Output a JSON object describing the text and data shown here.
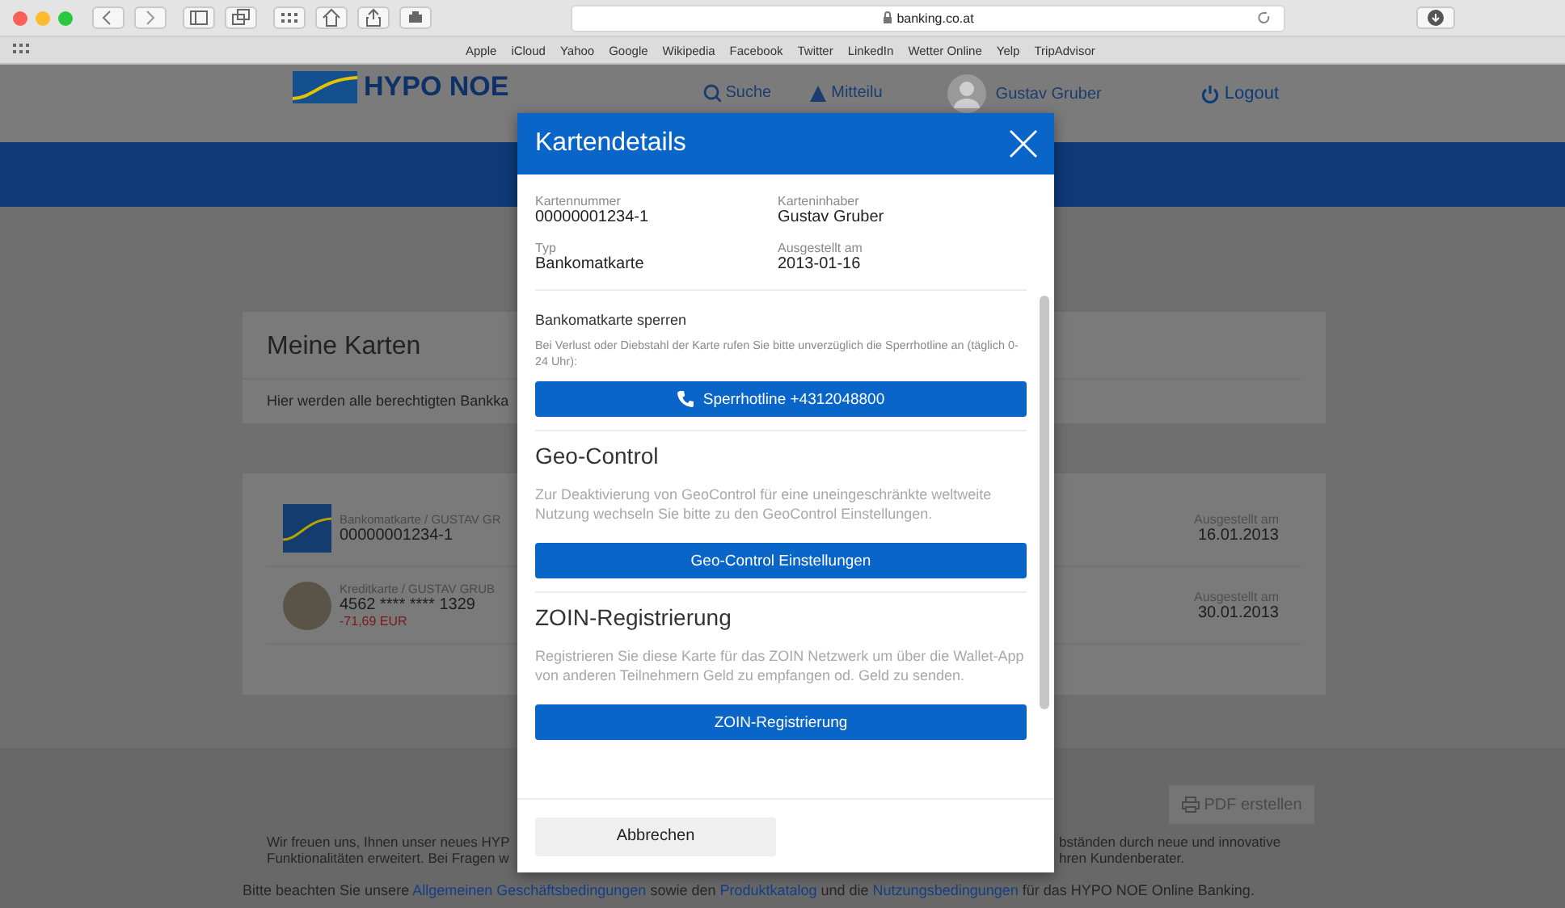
{
  "browser": {
    "url": "banking.co.at",
    "bookmarks": [
      "Apple",
      "iCloud",
      "Yahoo",
      "Google",
      "Wikipedia",
      "Facebook",
      "Twitter",
      "LinkedIn",
      "Wetter Online",
      "Yelp",
      "TripAdvisor"
    ]
  },
  "header": {
    "logo": "HYPO NOE",
    "search": "Suche",
    "messages": "Mitteilu",
    "user": "Gustav Gruber",
    "logout": "Logout"
  },
  "my_cards": {
    "title": "Meine Karten",
    "subtitle": "Hier werden alle berechtigten Bankka"
  },
  "cards": [
    {
      "kind": "debit",
      "owner": "Bankomatkarte / GUSTAV GR",
      "number": "00000001234-1",
      "issued_label": "Ausgestellt am",
      "issued_date": "16.01.2013"
    },
    {
      "kind": "credit",
      "owner": "Kreditkarte / GUSTAV GRUB",
      "number": "4562 **** **** 1329",
      "balance": "-71,69 EUR",
      "issued_label": "Ausgestellt am",
      "issued_date": "30.01.2013"
    }
  ],
  "footer": {
    "pdf_button": "PDF erstellen",
    "text_left": [
      "Wir freuen uns, Ihnen unser neues HYP",
      "Funktionalitäten erweitert. Bei Fragen w"
    ],
    "text_right": [
      "bständen durch neue und innovative",
      "hren Kundenberater."
    ],
    "notice": [
      {
        "kind": "text",
        "text": "Bitte beachten Sie unsere "
      },
      {
        "kind": "link",
        "text": "Allgemeinen Geschäftsbedingungen"
      },
      {
        "kind": "text",
        "text": " sowie den "
      },
      {
        "kind": "link",
        "text": "Produktkatalog"
      },
      {
        "kind": "text",
        "text": " und die "
      },
      {
        "kind": "link",
        "text": "Nutzungsbedingungen"
      },
      {
        "kind": "text",
        "text": " für das HYPO NOE Online Banking."
      }
    ]
  },
  "dialog": {
    "title": "Kartendetails",
    "fields": [
      {
        "label": "Kartennummer",
        "value": "00000001234-1"
      },
      {
        "label": "Karteninhaber",
        "value": "Gustav Gruber"
      },
      {
        "label": "Typ",
        "value": "Bankomatkarte"
      },
      {
        "label": "Ausgestellt am",
        "value": "2013-01-16"
      }
    ],
    "sections": [
      {
        "kind": "small",
        "title": "Bankomatkarte sperren",
        "text": "Bei Verlust oder Diebstahl der Karte rufen Sie bitte unverzüglich die Sperrhotline an (täglich 0-24 Uhr):",
        "button": "Sperrhotline +4312048800"
      },
      {
        "kind": "large",
        "title": "Geo-Control",
        "text": "Zur Deaktivierung von GeoControl für eine uneingeschränkte weltweite Nutzung wechseln Sie bitte zu den GeoControl Einstellungen.",
        "button": "Geo-Control Einstellungen"
      },
      {
        "kind": "large",
        "title": "ZOIN-Registrierung",
        "text": "Registrieren Sie diese Karte für das ZOIN Netzwerk um über die Wallet-App von anderen Teilnehmern Geld zu empfangen od. Geld zu senden.",
        "button": "ZOIN-Registrierung"
      }
    ],
    "cancel": "Abbrechen"
  }
}
